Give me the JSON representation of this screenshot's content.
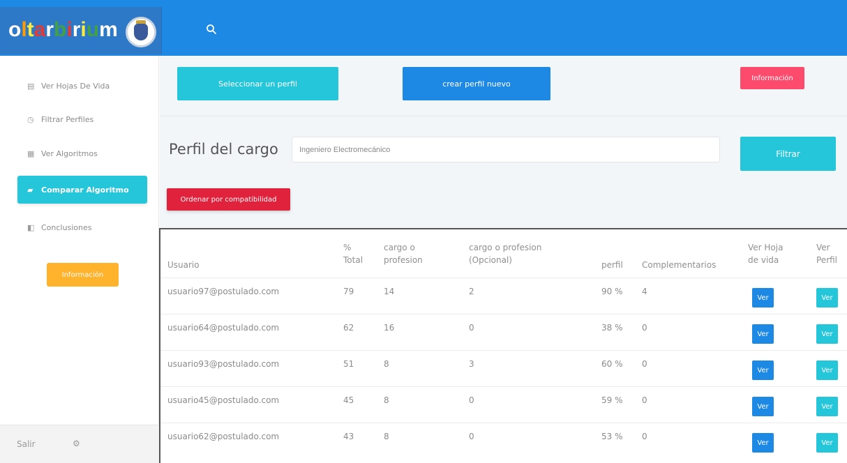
{
  "brand": {
    "letters": [
      {
        "ch": "o",
        "color": "#ffffff"
      },
      {
        "ch": "l",
        "color": "#ff9a00"
      },
      {
        "ch": "t",
        "color": "#ffeb3b"
      },
      {
        "ch": "a",
        "color": "#e53935"
      },
      {
        "ch": "r",
        "color": "#ffffff"
      },
      {
        "ch": "b",
        "color": "#43a047"
      },
      {
        "ch": "i",
        "color": "#e53935"
      },
      {
        "ch": "r",
        "color": "#ffffff"
      },
      {
        "ch": "i",
        "color": "#ffeb3b"
      },
      {
        "ch": "u",
        "color": "#43a047"
      },
      {
        "ch": "m",
        "color": "#ffffff"
      }
    ],
    "accent": "#1e88e5"
  },
  "sidebar": {
    "items": [
      {
        "label": "Ver Hojas De Vida",
        "icon": "id-card-icon"
      },
      {
        "label": "Filtrar Perfiles",
        "icon": "clock-icon"
      },
      {
        "label": "Ver Algoritmos",
        "icon": "calendar-icon"
      },
      {
        "label": "Comparar Algoritmo",
        "icon": "folder-icon"
      },
      {
        "label": "Conclusiones",
        "icon": "columns-icon"
      }
    ],
    "info_label": "Información",
    "logout_label": "Salir"
  },
  "toolbar": {
    "select_label": "Seleccionar un perfil",
    "create_label": "crear perfil nuevo",
    "info_label": "Información"
  },
  "filter": {
    "label": "Perfil del cargo",
    "value": "Ingeniero Electromecánico",
    "filter_label": "Filtrar",
    "sort_label": "Ordenar por compatibilidad"
  },
  "table": {
    "headers": {
      "usuario": "Usuario",
      "total_1": "%",
      "total_2": "Total",
      "cargo_1": "cargo o",
      "cargo_2": "profesion",
      "cargo_opc_1": "cargo o profesion",
      "cargo_opc_2": "(Opcional)",
      "perfil": "perfil",
      "complementarios": "Complementarios",
      "ver_hoja_1": "Ver Hoja",
      "ver_hoja_2": "de vida",
      "ver_perfil_1": "Ver",
      "ver_perfil_2": "Perfil"
    },
    "rows": [
      {
        "usuario": "usuario97@postulado.com",
        "total": "79",
        "cargo": "14",
        "opcional": "2",
        "perfil": "90 %",
        "complementarios": "4",
        "ver": "Ver"
      },
      {
        "usuario": "usuario64@postulado.com",
        "total": "62",
        "cargo": "16",
        "opcional": "0",
        "perfil": "38 %",
        "complementarios": "0",
        "ver": "Ver"
      },
      {
        "usuario": "usuario93@postulado.com",
        "total": "51",
        "cargo": "8",
        "opcional": "3",
        "perfil": "60 %",
        "complementarios": "0",
        "ver": "Ver"
      },
      {
        "usuario": "usuario45@postulado.com",
        "total": "45",
        "cargo": "8",
        "opcional": "0",
        "perfil": "59 %",
        "complementarios": "0",
        "ver": "Ver"
      },
      {
        "usuario": "usuario62@postulado.com",
        "total": "43",
        "cargo": "8",
        "opcional": "0",
        "perfil": "53 %",
        "complementarios": "0",
        "ver": "Ver"
      }
    ]
  }
}
